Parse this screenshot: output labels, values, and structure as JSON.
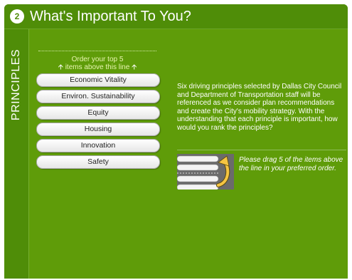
{
  "header": {
    "step_number": "2",
    "title": "What's Important To You?"
  },
  "side_tab": {
    "label": "PRINCIPLES"
  },
  "ranking": {
    "instruction_line1": "Order your top 5",
    "instruction_line2": "items above this line",
    "items": [
      {
        "label": "Economic Vitality"
      },
      {
        "label": "Environ. Sustainability"
      },
      {
        "label": "Equity"
      },
      {
        "label": "Housing"
      },
      {
        "label": "Innovation"
      },
      {
        "label": "Safety"
      }
    ]
  },
  "description": "Six driving principles selected by Dallas City Council and Department of Transportation staff will be referenced as we consider plan recommendations and create the City's mobility strategy. With the understanding that each principle is important, how would you rank the principles?",
  "drag_hint": "Please drag 5 of the items above the line in your preferred order.",
  "colors": {
    "panel_green": "#4f8d08",
    "content_green": "#5f9c09",
    "instruction_text": "#e8f5b0",
    "arrow_yellow": "#f5c542"
  },
  "icons": {
    "step": "step-number-badge",
    "arrows": "arrow-up-icon",
    "drag_illustration": "drag-up-curved-arrow-icon"
  }
}
